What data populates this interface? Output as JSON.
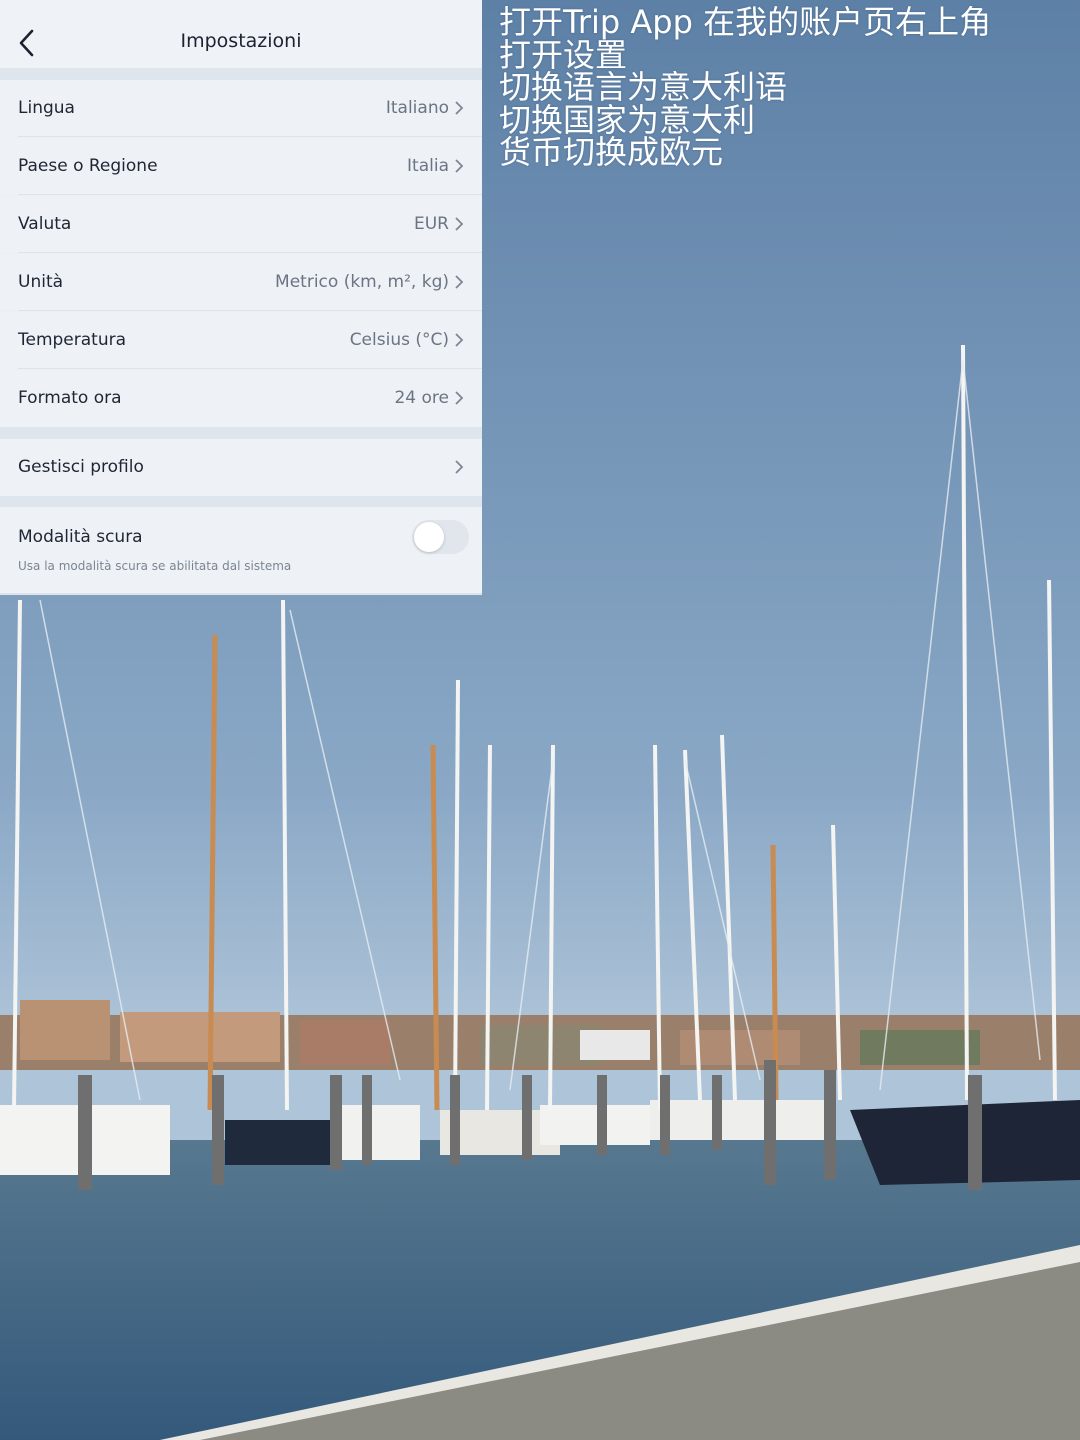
{
  "caption": {
    "lines": [
      "打开Trip App 在我的账户页右上角",
      "打开设置",
      "切换语言为意大利语",
      "切换国家为意大利",
      "货币切换成欧元"
    ]
  },
  "settings": {
    "title": "Impostazioni",
    "rows": [
      {
        "label": "Lingua",
        "value": "Italiano"
      },
      {
        "label": "Paese o Regione",
        "value": "Italia"
      },
      {
        "label": "Valuta",
        "value": "EUR"
      },
      {
        "label": "Unità",
        "value": "Metrico (km, m², kg)"
      },
      {
        "label": "Temperatura",
        "value": "Celsius (°C)"
      },
      {
        "label": "Formato ora",
        "value": "24 ore"
      }
    ],
    "profile": {
      "label": "Gestisci profilo"
    },
    "dark_mode": {
      "label": "Modalità scura",
      "description": "Usa la modalità scura se abilitata dal sistema",
      "enabled": false
    }
  },
  "colors": {
    "sky_top": "#5f83a8",
    "sky_bottom": "#a9c1d6",
    "water": "#3e6384",
    "panel_bg": "#eef2f7"
  }
}
